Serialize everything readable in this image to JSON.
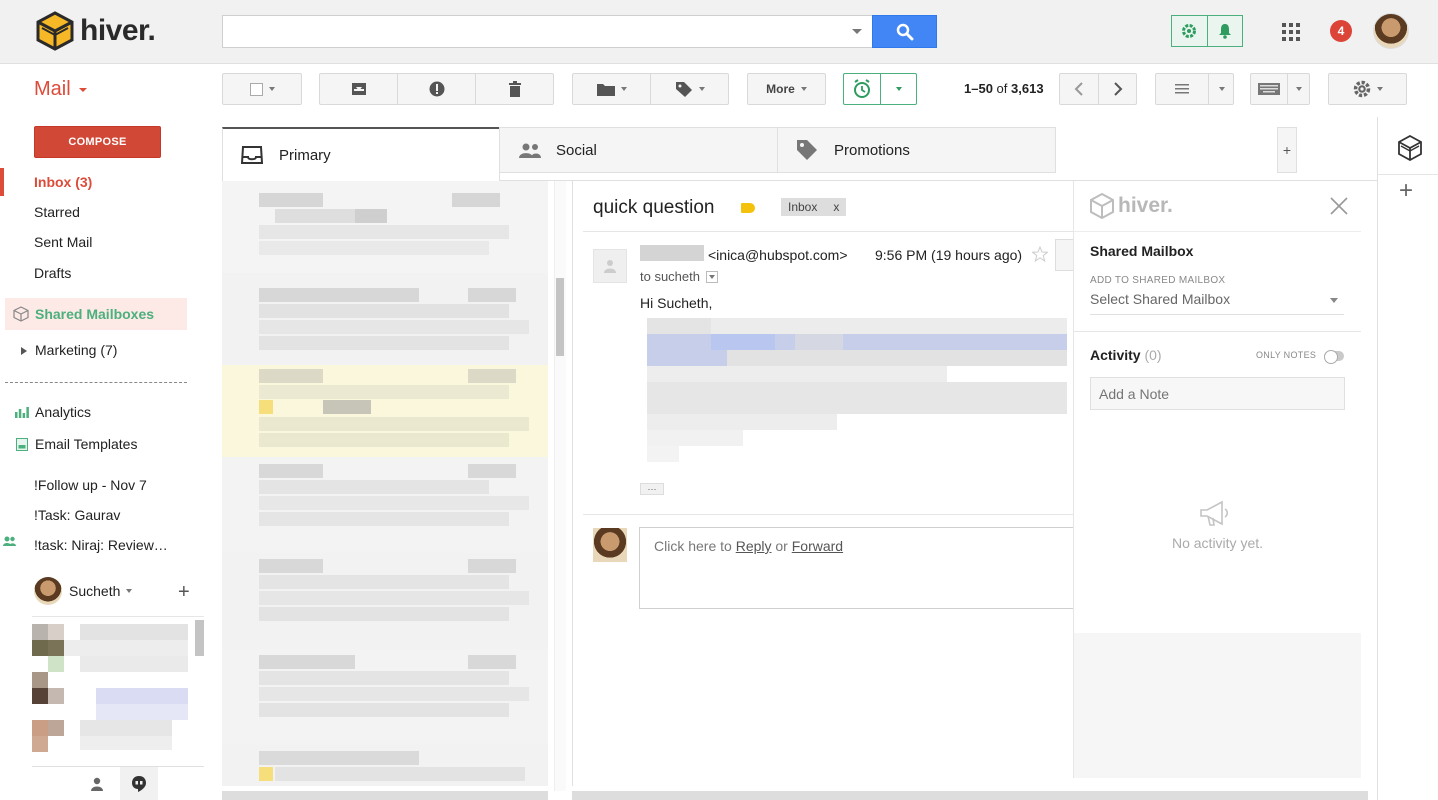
{
  "header": {
    "brand": "hiver.",
    "notification_count": "4"
  },
  "toolbar": {
    "mail_label": "Mail",
    "more_label": "More",
    "pager_range": "1–50",
    "pager_of": "of",
    "pager_total": "3,613"
  },
  "sidebar": {
    "compose_label": "COMPOSE",
    "items": [
      {
        "label": "Inbox (3)"
      },
      {
        "label": "Starred"
      },
      {
        "label": "Sent Mail"
      },
      {
        "label": "Drafts"
      }
    ],
    "shared_mailboxes_label": "Shared Mailboxes",
    "marketing_label": "Marketing (7)",
    "analytics_label": "Analytics",
    "templates_label": "Email Templates",
    "labels": [
      {
        "label": "!Follow up - Nov 7"
      },
      {
        "label": "!Task: Gaurav"
      },
      {
        "label": "!task: Niraj: Review…"
      }
    ],
    "user_name": "Sucheth"
  },
  "tabs": [
    {
      "label": "Primary"
    },
    {
      "label": "Social"
    },
    {
      "label": "Promotions"
    }
  ],
  "message": {
    "subject": "quick question",
    "label_chip": "Inbox",
    "label_chip_close": "x",
    "from_email": "<inica@hubspot.com>",
    "time": "9:56 PM (19 hours ago)",
    "to_line": "to sucheth",
    "greeting": "Hi Sucheth,",
    "ellipsis": "···",
    "reply_prefix": "Click here to",
    "reply_link": "Reply",
    "reply_or": "or",
    "forward_link": "Forward"
  },
  "hiver_panel": {
    "logo_text": "hiver.",
    "shared_mailbox_title": "Shared Mailbox",
    "add_to_label": "ADD TO SHARED MAILBOX",
    "select_placeholder": "Select Shared Mailbox",
    "activity_title": "Activity",
    "activity_count": "(0)",
    "only_notes_label": "ONLY NOTES",
    "note_placeholder": "Add a Note",
    "no_activity": "No activity yet."
  },
  "colors": {
    "accent_red": "#dd4b39",
    "search_blue": "#4285f4",
    "hiver_green": "#4caf7e",
    "badge_red": "#db4437"
  }
}
